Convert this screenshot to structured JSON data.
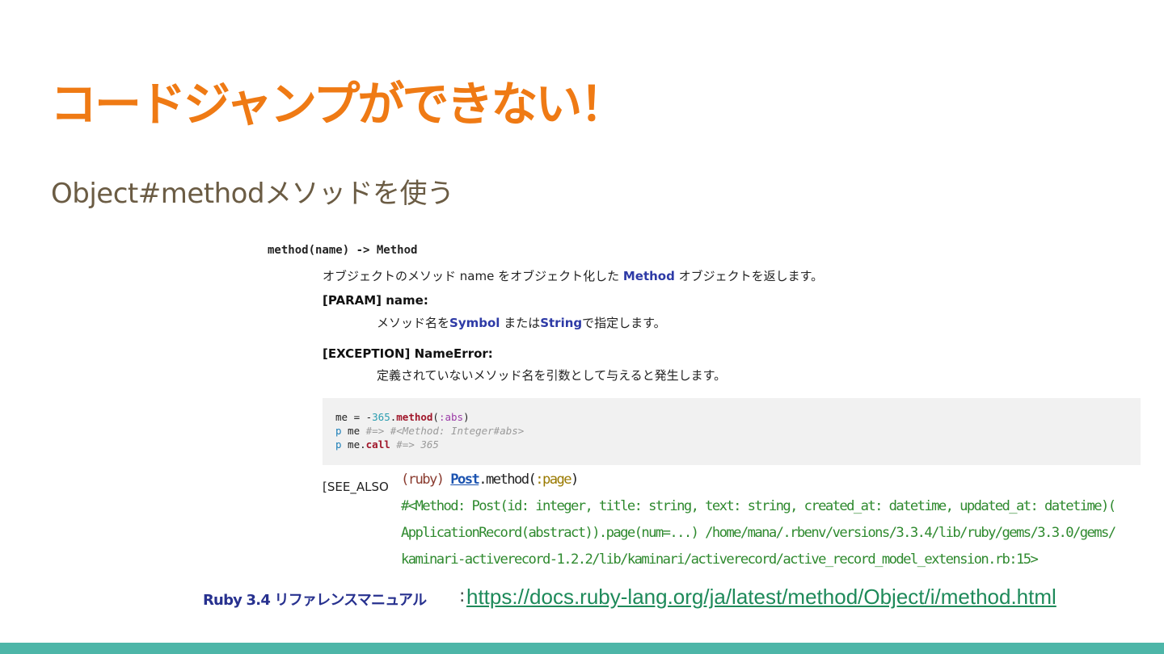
{
  "slide": {
    "title": "コードジャンプができない！",
    "subtitle": "Object#methodメソッドを使う"
  },
  "reference": {
    "signature": "method(name) -> Method",
    "description": {
      "before": "オブジェクトのメソッド name をオブジェクト化した ",
      "term": "Method",
      "after": " オブジェクトを返します。"
    },
    "param_heading": "[PARAM] name:",
    "param_desc": {
      "part1": "メソッド名を",
      "term1": "Symbol",
      "part2": " または",
      "term2": "String",
      "part3": "で指定します。"
    },
    "exception_heading": "[EXCEPTION] NameError:",
    "exception_desc": "定義されていないメソッド名を引数として与えると発生します。",
    "code": {
      "line1": {
        "var": "me = -",
        "num": "365",
        "dot": ".",
        "meth": "method",
        "open": "(",
        "sym": ":abs",
        "close": ")"
      },
      "line2": {
        "kw": "p",
        "rest": " me ",
        "comment": "#=> #<Method: Integer#abs>"
      },
      "line3": {
        "kw": "p",
        "rest": " me.",
        "meth": "call",
        "comment": " #=> 365"
      }
    },
    "see_also": "[SEE_ALSO"
  },
  "console": {
    "prompt": "(ruby) ",
    "const": "Post",
    "dot": ".",
    "method": "method(",
    "symbol": ":page",
    "close": ")",
    "output_lines": [
      "#<Method: Post(id: integer, title: string, text: string, created_at: datetime, updated_at: datetime)(",
      "ApplicationRecord(abstract)).page(num=...) /home/mana/.rbenv/versions/3.3.4/lib/ruby/gems/3.3.0/gems/",
      "kaminari-activerecord-1.2.2/lib/kaminari/activerecord/active_record_model_extension.rb:15>"
    ]
  },
  "footer": {
    "label": "Ruby 3.4 リファレンスマニュアル",
    "colon": ":",
    "url": "https://docs.ruby-lang.org/ja/latest/method/Object/i/method.html"
  },
  "colors": {
    "title": "#ef7a14",
    "subtitle": "#6b5c44",
    "link_term": "#2d3aa6",
    "footer_label": "#27318f",
    "footer_link": "#1e8a5a",
    "bottom_bar": "#4db6a8"
  }
}
